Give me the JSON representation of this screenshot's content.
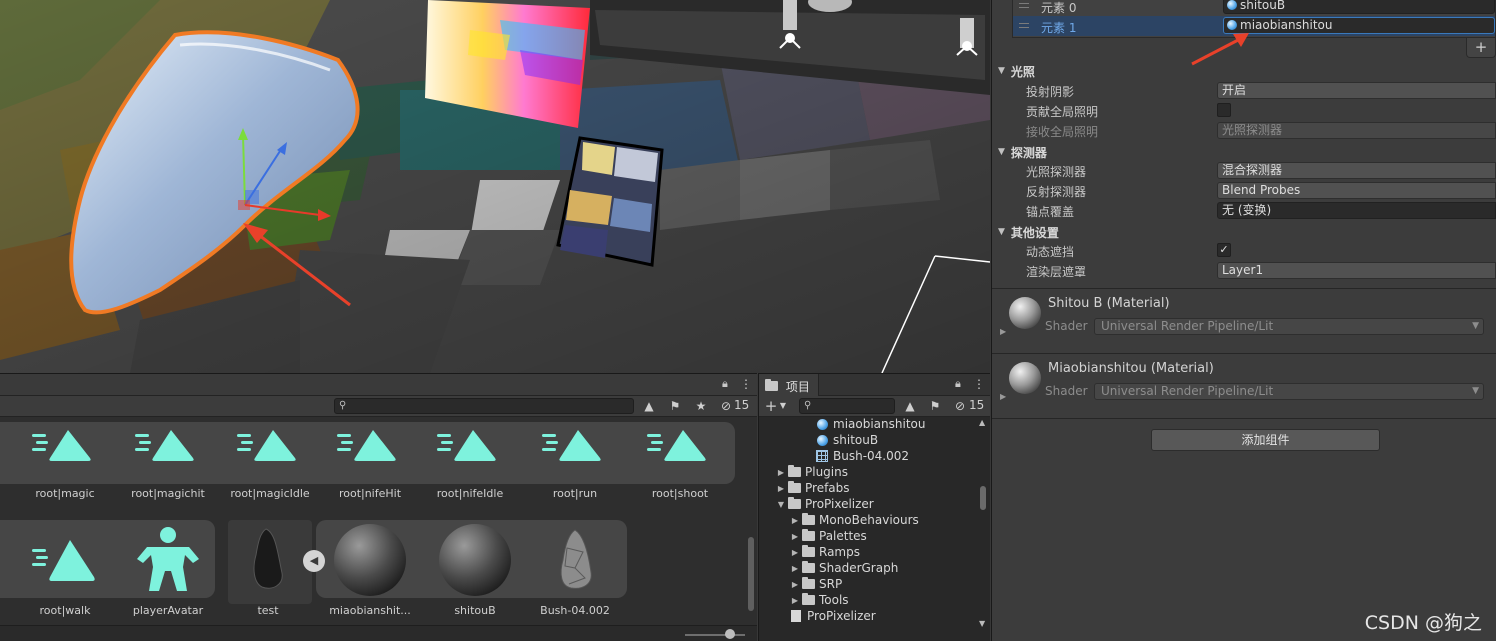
{
  "scene": {
    "arrow_color": "#e8412a",
    "selection_outline": "#f07a24"
  },
  "assets": {
    "count": "15",
    "row1": [
      {
        "label": "root|magic"
      },
      {
        "label": "root|magichit"
      },
      {
        "label": "root|magicIdle"
      },
      {
        "label": "root|nifeHit"
      },
      {
        "label": "root|nifeIdle"
      },
      {
        "label": "root|run"
      },
      {
        "label": "root|shoot"
      }
    ],
    "row2": [
      {
        "label": "root|walk"
      },
      {
        "label": "playerAvatar"
      },
      {
        "label": "test"
      },
      {
        "label": "miaobianshit..."
      },
      {
        "label": "shitouB"
      },
      {
        "label": "Bush-04.002"
      }
    ],
    "accent": "#7ef2dd"
  },
  "project": {
    "tab_label": "项目",
    "count": "15",
    "items": [
      {
        "label": "miaobianshitou",
        "type": "material"
      },
      {
        "label": "shitouB",
        "type": "material"
      },
      {
        "label": "Bush-04.002",
        "type": "mesh"
      },
      {
        "label": "Plugins",
        "type": "folder"
      },
      {
        "label": "Prefabs",
        "type": "folder"
      },
      {
        "label": "ProPixelizer",
        "type": "folder"
      },
      {
        "label": "MonoBehaviours",
        "type": "folder"
      },
      {
        "label": "Palettes",
        "type": "folder"
      },
      {
        "label": "Ramps",
        "type": "folder"
      },
      {
        "label": "ShaderGraph",
        "type": "folder"
      },
      {
        "label": "SRP",
        "type": "folder"
      },
      {
        "label": "Tools",
        "type": "folder"
      },
      {
        "label": "ProPixelizer",
        "type": "file"
      }
    ]
  },
  "inspector": {
    "elements": [
      {
        "label": "元素 0",
        "value": "shitouB"
      },
      {
        "label": "元素 1",
        "value": "miaobianshitou"
      }
    ],
    "lighting": {
      "title": "光照",
      "cast_shadows_label": "投射阴影",
      "cast_shadows_value": "开启",
      "contribute_gi_label": "贡献全局照明",
      "receive_gi_label": "接收全局照明",
      "receive_gi_value": "光照探测器"
    },
    "probes": {
      "title": "探测器",
      "light_probes_label": "光照探测器",
      "light_probes_value": "混合探测器",
      "reflection_probes_label": "反射探测器",
      "reflection_probes_value": "Blend Probes",
      "anchor_label": "锚点覆盖",
      "anchor_value": "无 (变换)"
    },
    "other": {
      "title": "其他设置",
      "dynamic_occlusion_label": "动态遮挡",
      "dynamic_occlusion_checked": "✓",
      "rendering_layer_label": "渲染层遮罩",
      "rendering_layer_value": "Layer1"
    },
    "materials": [
      {
        "title": "Shitou B (Material)",
        "shader_label": "Shader",
        "shader_value": "Universal Render Pipeline/Lit"
      },
      {
        "title": "Miaobianshitou (Material)",
        "shader_label": "Shader",
        "shader_value": "Universal Render Pipeline/Lit"
      }
    ],
    "add_component": "添加组件"
  },
  "watermark": "CSDN @狗之"
}
